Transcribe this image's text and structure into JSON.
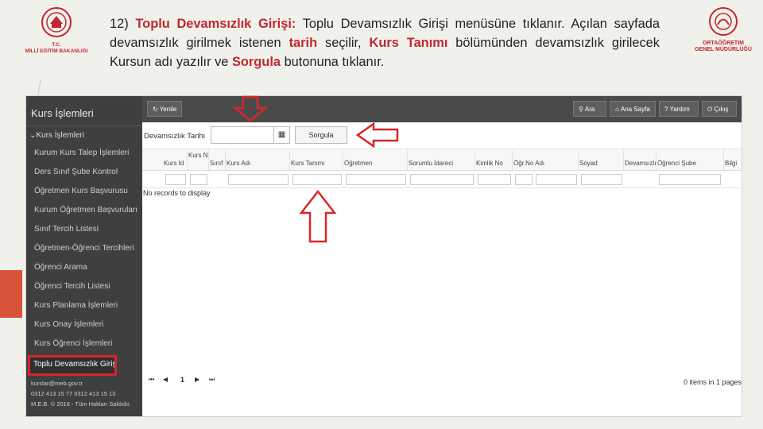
{
  "logos": {
    "left_line1": "T.C.",
    "left_line2": "MİLLÎ EĞİTİM BAKANLIĞI",
    "right_line1": "ORTAÖĞRETİM",
    "right_line2": "GENEL MÜDÜRLÜĞÜ"
  },
  "instruction": {
    "number": "12)",
    "title": "Toplu Devamsızlık Girişi:",
    "part1": "Toplu Devamsızlık Girişi menüsüne tıklanır. Açılan sayfada devamsızlık girilmek istenen",
    "term1": "tarih",
    "part2": "seçilir,",
    "term2": "Kurs Tanımı",
    "part3": "bölümünden devamsızlık girilecek Kursun adı yazılır ve",
    "term3": "Sorgula",
    "part4": "butonuna tıklanır."
  },
  "sidebar": {
    "title": "Kurs İşlemleri",
    "group": "Kurs İşlemleri",
    "items": [
      "Kurum Kurs Talep İşlemleri",
      "Ders Sınıf Şube Kontrol",
      "Öğretmen Kurs Başvurusu",
      "Kurum Öğretmen Başvuruları",
      "Sınıf Tercih Listesi",
      "Öğretmen-Öğrenci Tercihleri",
      "Öğrenci Arama",
      "Öğrenci Tercih Listesi",
      "Kurs Planlama İşlemleri",
      "Kurs Onay İşlemleri",
      "Kurs Öğrenci İşlemleri",
      "Toplu Devamsızlık Girişi"
    ],
    "footer_email": "kurslar@meb.gov.tr",
    "footer_phone": "0312 413 15 77  0312 413 15 13",
    "footer_copy": "M.E.B. © 2016 - Tüm Hakları Saklıdır."
  },
  "toolbar": {
    "refresh": "Yenile",
    "search": "Ara",
    "home": "Ana Sayfa",
    "help": "Yardım",
    "exit": "Çıkış"
  },
  "filter": {
    "date_label": "Devamsızlık Tarihi",
    "date_value": "",
    "query_button": "Sorgula"
  },
  "grid": {
    "columns": [
      "Kurs Id",
      "Kurs No",
      "Sınıf",
      "Kurs Adı",
      "Kurs Tanımı",
      "Öğretmen",
      "Sorumlu İdareci",
      "Kimlik No",
      "Öğr.No Adı",
      "Soyad",
      "Devamsızlık",
      "Öğrenci Şube",
      "Bilgi"
    ],
    "empty_text": "No records to display",
    "pager_page": "1",
    "pager_info": "0 items in 1 pages"
  },
  "colors": {
    "accent_red": "#d7262b",
    "sidebar_bg": "#3f3f3f",
    "topbar_bg": "#4a4a4a"
  }
}
